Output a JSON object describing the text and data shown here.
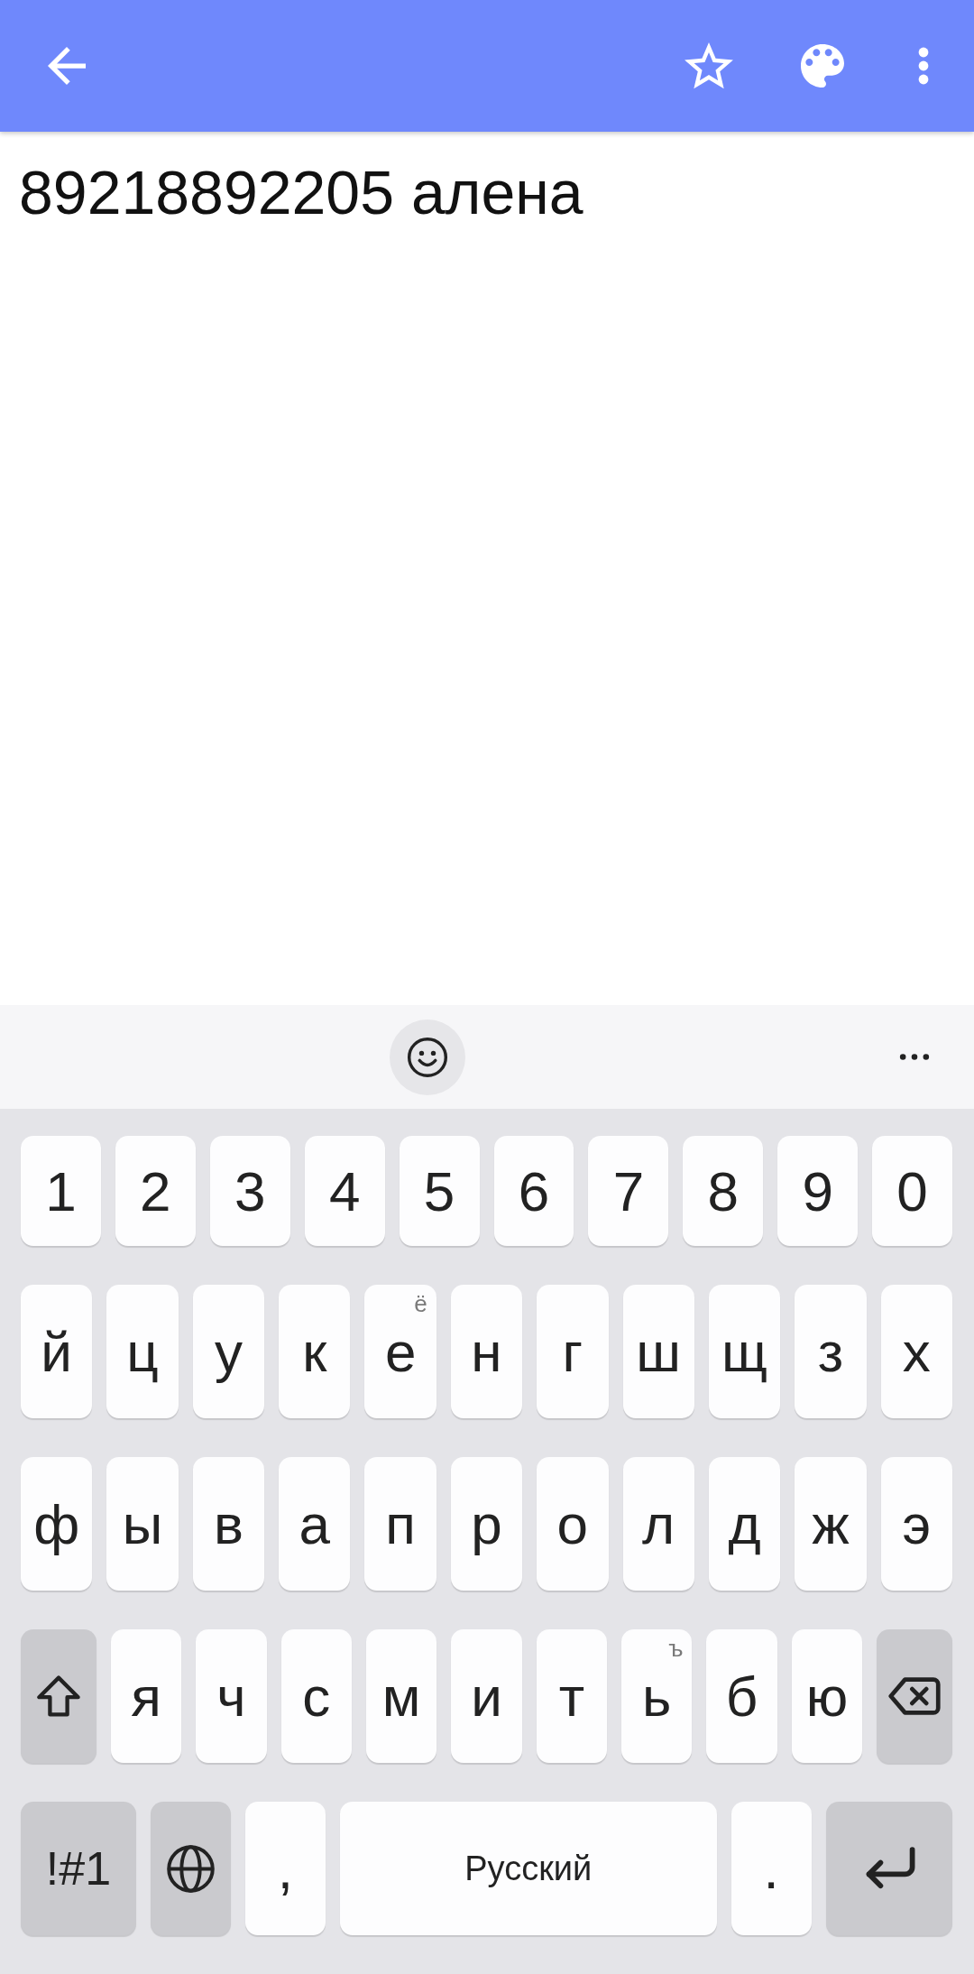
{
  "note": {
    "text": "89218892205 алена"
  },
  "keyboard": {
    "rows": [
      {
        "keys": [
          {
            "kind": "char",
            "label": "1"
          },
          {
            "kind": "char",
            "label": "2"
          },
          {
            "kind": "char",
            "label": "3"
          },
          {
            "kind": "char",
            "label": "4"
          },
          {
            "kind": "char",
            "label": "5"
          },
          {
            "kind": "char",
            "label": "6"
          },
          {
            "kind": "char",
            "label": "7"
          },
          {
            "kind": "char",
            "label": "8"
          },
          {
            "kind": "char",
            "label": "9"
          },
          {
            "kind": "char",
            "label": "0"
          }
        ]
      },
      {
        "keys": [
          {
            "kind": "char",
            "label": "й"
          },
          {
            "kind": "char",
            "label": "ц"
          },
          {
            "kind": "char",
            "label": "у"
          },
          {
            "kind": "char",
            "label": "к"
          },
          {
            "kind": "char",
            "label": "е",
            "hint": "ё"
          },
          {
            "kind": "char",
            "label": "н"
          },
          {
            "kind": "char",
            "label": "г"
          },
          {
            "kind": "char",
            "label": "ш"
          },
          {
            "kind": "char",
            "label": "щ"
          },
          {
            "kind": "char",
            "label": "з"
          },
          {
            "kind": "char",
            "label": "х"
          }
        ]
      },
      {
        "keys": [
          {
            "kind": "char",
            "label": "ф"
          },
          {
            "kind": "char",
            "label": "ы"
          },
          {
            "kind": "char",
            "label": "в"
          },
          {
            "kind": "char",
            "label": "а"
          },
          {
            "kind": "char",
            "label": "п"
          },
          {
            "kind": "char",
            "label": "р"
          },
          {
            "kind": "char",
            "label": "о"
          },
          {
            "kind": "char",
            "label": "л"
          },
          {
            "kind": "char",
            "label": "д"
          },
          {
            "kind": "char",
            "label": "ж"
          },
          {
            "kind": "char",
            "label": "э"
          }
        ]
      },
      {
        "keys": [
          {
            "kind": "shift"
          },
          {
            "kind": "char",
            "label": "я"
          },
          {
            "kind": "char",
            "label": "ч"
          },
          {
            "kind": "char",
            "label": "с"
          },
          {
            "kind": "char",
            "label": "м"
          },
          {
            "kind": "char",
            "label": "и"
          },
          {
            "kind": "char",
            "label": "т"
          },
          {
            "kind": "char",
            "label": "ь",
            "hint": "ъ"
          },
          {
            "kind": "char",
            "label": "б"
          },
          {
            "kind": "char",
            "label": "ю"
          },
          {
            "kind": "backspace"
          }
        ]
      },
      {
        "keys": [
          {
            "kind": "symbols",
            "label": "!#1"
          },
          {
            "kind": "language"
          },
          {
            "kind": "char",
            "label": ","
          },
          {
            "kind": "space",
            "label": "Русский"
          },
          {
            "kind": "char",
            "label": "."
          },
          {
            "kind": "enter"
          }
        ]
      }
    ]
  }
}
